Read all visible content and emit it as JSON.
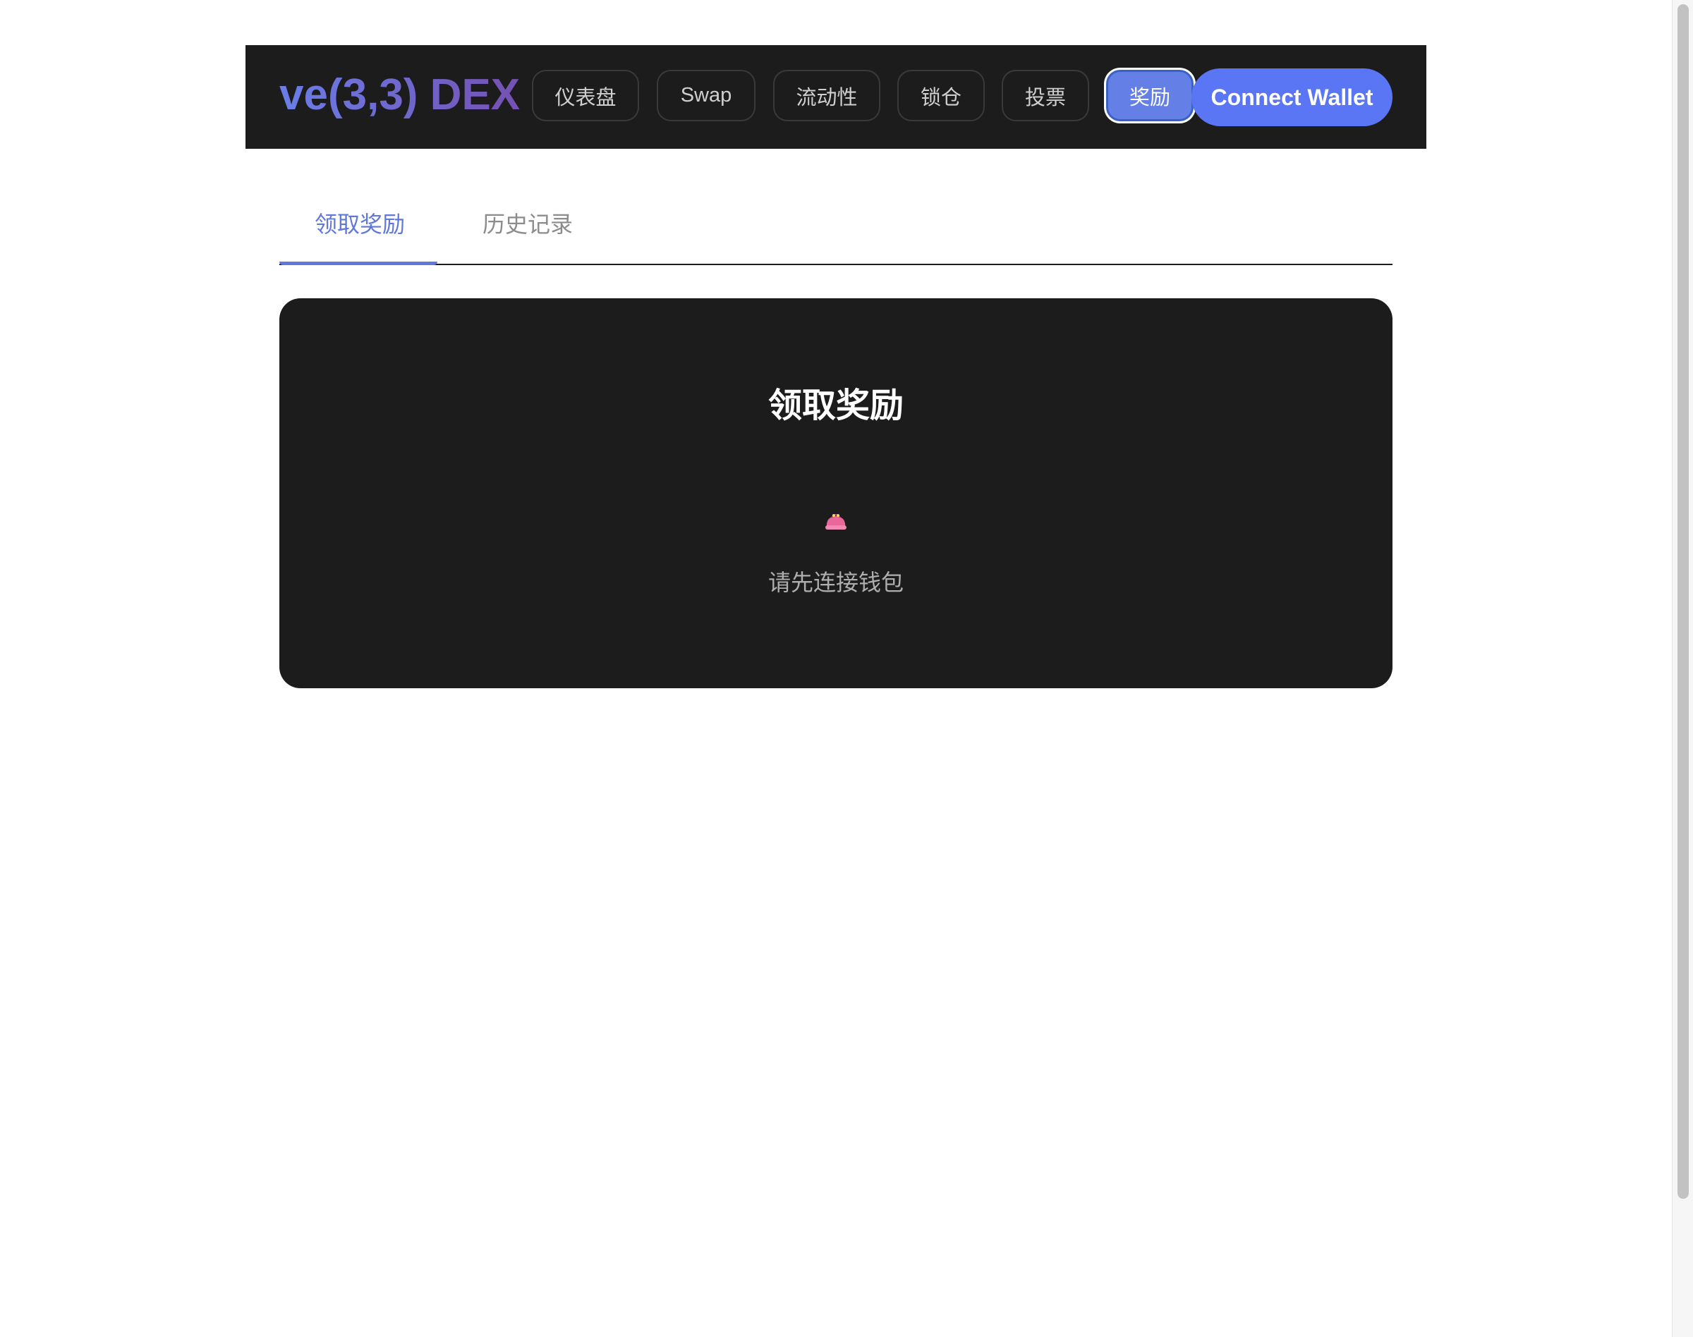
{
  "header": {
    "logo": "ve(3,3) DEX",
    "nav": [
      {
        "label": "仪表盘",
        "active": false
      },
      {
        "label": "Swap",
        "active": false
      },
      {
        "label": "流动性",
        "active": false
      },
      {
        "label": "锁仓",
        "active": false
      },
      {
        "label": "投票",
        "active": false
      },
      {
        "label": "奖励",
        "active": true
      }
    ],
    "connect_label": "Connect Wallet"
  },
  "tabs": [
    {
      "label": "领取奖励",
      "active": true
    },
    {
      "label": "历史记录",
      "active": false
    }
  ],
  "card": {
    "title": "领取奖励",
    "icon": "purse-icon",
    "message": "请先连接钱包"
  },
  "colors": {
    "accent": "#6177db",
    "connect": "#5b76f4",
    "panel": "#1c1c1c"
  }
}
